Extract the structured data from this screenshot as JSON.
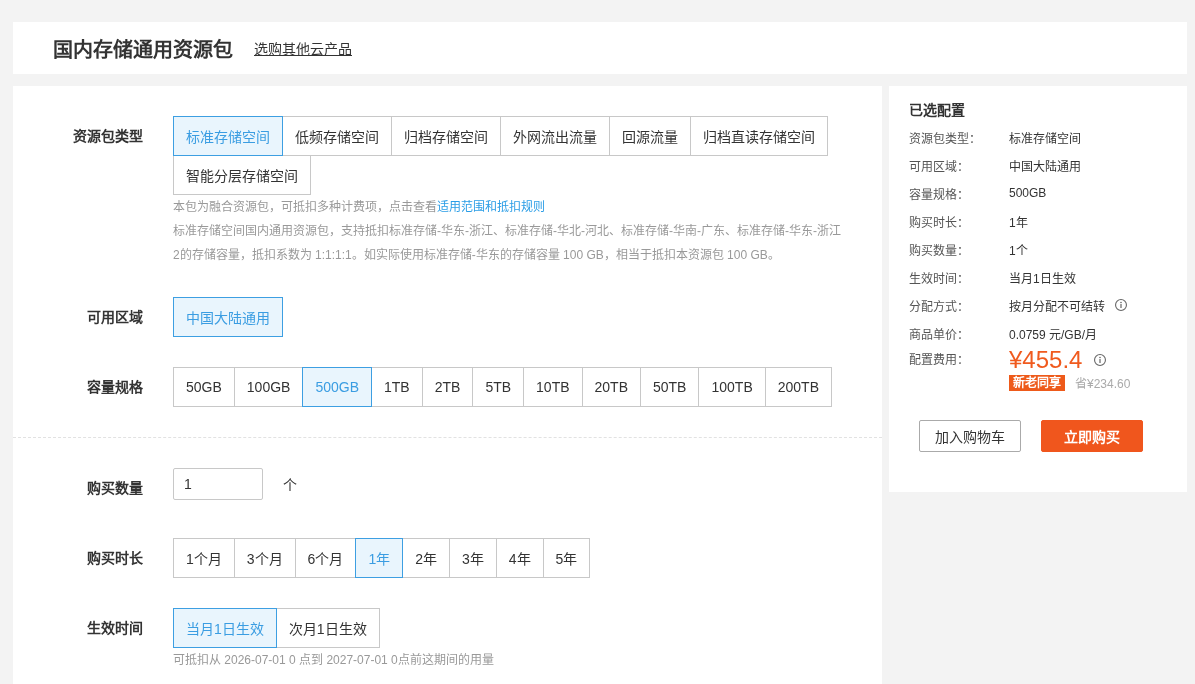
{
  "header": {
    "title": "国内存储通用资源包",
    "link": "选购其他云产品"
  },
  "form": {
    "sections": [
      {
        "rows": [
          {
            "kind": "options",
            "label": "资源包类型",
            "options": [
              {
                "label": "标准存储空间",
                "selected": true
              },
              {
                "label": "低频存储空间",
                "selected": false
              },
              {
                "label": "归档存储空间",
                "selected": false
              },
              {
                "label": "外网流出流量",
                "selected": false
              },
              {
                "label": "回源流量",
                "selected": false
              },
              {
                "label": "归档直读存储空间",
                "selected": false
              },
              {
                "label": "智能分层存储空间",
                "selected": false
              }
            ],
            "notes": [
              {
                "text": "本包为融合资源包，可抵扣多种计费项，点击查看",
                "link": "适用范围和抵扣规则"
              },
              {
                "text": "标准存储空间国内通用资源包，支持抵扣标准存储-华东-浙江、标准存储-华北-河北、标准存储-华南-广东、标准存储-华东-浙江2的存储容量，抵扣系数为 1:1:1:1。如实际使用标准存储-华东的存储容量 100 GB，相当于抵扣本资源包 100 GB。"
              }
            ]
          },
          {
            "kind": "options",
            "label": "可用区域",
            "options": [
              {
                "label": "中国大陆通用",
                "selected": true
              }
            ]
          },
          {
            "kind": "options",
            "label": "容量规格",
            "options": [
              {
                "label": "50GB",
                "selected": false
              },
              {
                "label": "100GB",
                "selected": false
              },
              {
                "label": "500GB",
                "selected": true
              },
              {
                "label": "1TB",
                "selected": false
              },
              {
                "label": "2TB",
                "selected": false
              },
              {
                "label": "5TB",
                "selected": false
              },
              {
                "label": "10TB",
                "selected": false
              },
              {
                "label": "20TB",
                "selected": false
              },
              {
                "label": "50TB",
                "selected": false
              },
              {
                "label": "100TB",
                "selected": false
              },
              {
                "label": "200TB",
                "selected": false
              }
            ]
          }
        ]
      },
      {
        "rows": [
          {
            "kind": "quantity",
            "label": "购买数量",
            "value": "1",
            "unit": "个"
          },
          {
            "kind": "options",
            "label": "购买时长",
            "options": [
              {
                "label": "1个月",
                "selected": false
              },
              {
                "label": "3个月",
                "selected": false
              },
              {
                "label": "6个月",
                "selected": false
              },
              {
                "label": "1年",
                "selected": true
              },
              {
                "label": "2年",
                "selected": false
              },
              {
                "label": "3年",
                "selected": false
              },
              {
                "label": "4年",
                "selected": false
              },
              {
                "label": "5年",
                "selected": false
              }
            ]
          },
          {
            "kind": "options",
            "label": "生效时间",
            "options": [
              {
                "label": "当月1日生效",
                "selected": true
              },
              {
                "label": "次月1日生效",
                "selected": false
              }
            ],
            "notes": [
              {
                "text": "可抵扣从 2026-07-01 0 点到 2027-07-01 0点前这期间的用量"
              }
            ]
          }
        ]
      }
    ]
  },
  "summary": {
    "title": "已选配置",
    "items": [
      {
        "label": "资源包类型：",
        "value": "标准存储空间",
        "info": false
      },
      {
        "label": "可用区域：",
        "value": "中国大陆通用",
        "info": false
      },
      {
        "label": "容量规格：",
        "value": "500GB",
        "info": false
      },
      {
        "label": "购买时长：",
        "value": "1年",
        "info": false
      },
      {
        "label": "购买数量：",
        "value": "1个",
        "info": false
      },
      {
        "label": "生效时间：",
        "value": "当月1日生效",
        "info": false
      },
      {
        "label": "分配方式：",
        "value": "按月分配不可结转",
        "info": true
      },
      {
        "label": "商品单价：",
        "value": "0.0759 元/GB/月",
        "info": false
      }
    ],
    "price": {
      "label": "配置费用：",
      "amount": "¥455.4",
      "info": true,
      "badge": "新老同享",
      "saving": "省¥234.60"
    },
    "buttons": [
      {
        "label": "加入购物车",
        "kind": "outline"
      },
      {
        "label": "立即购买",
        "kind": "filled"
      }
    ]
  }
}
